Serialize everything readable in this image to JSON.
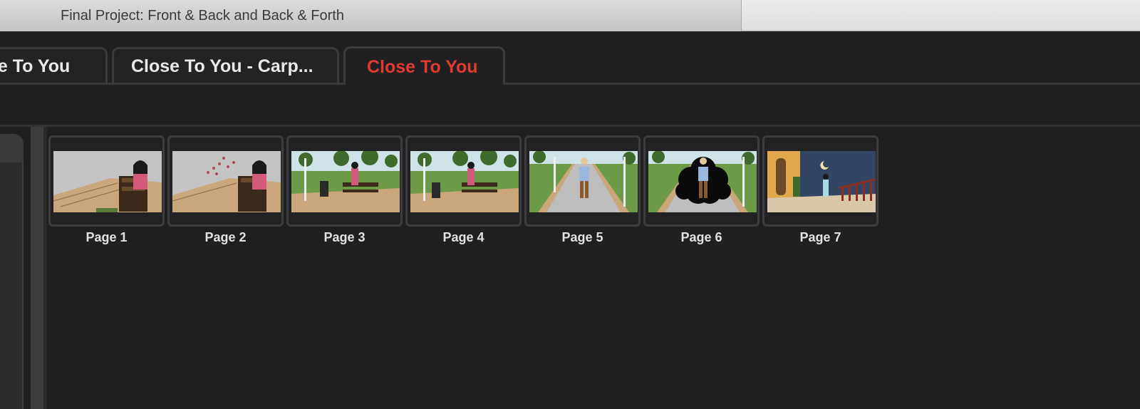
{
  "window": {
    "title": "Final Project: Front & Back and Back & Forth"
  },
  "tabs": [
    {
      "label": "se To You",
      "active": false
    },
    {
      "label": "Close To You - Carp...",
      "active": false
    },
    {
      "label": "Close To You",
      "active": true
    }
  ],
  "colors": {
    "active_tab": "#e03a2f",
    "background": "#201f21"
  },
  "pages": [
    {
      "label": "Page 1",
      "thumbnail": "woman-on-bench-thumbnail"
    },
    {
      "label": "Page 2",
      "thumbnail": "woman-on-bench-birds-thumbnail"
    },
    {
      "label": "Page 3",
      "thumbnail": "park-bench-thumbnail"
    },
    {
      "label": "Page 4",
      "thumbnail": "park-bench-thumbnail"
    },
    {
      "label": "Page 5",
      "thumbnail": "man-walking-path-thumbnail"
    },
    {
      "label": "Page 6",
      "thumbnail": "man-walking-dark-cloud-thumbnail"
    },
    {
      "label": "Page 7",
      "thumbnail": "night-balcony-thumbnail"
    }
  ]
}
